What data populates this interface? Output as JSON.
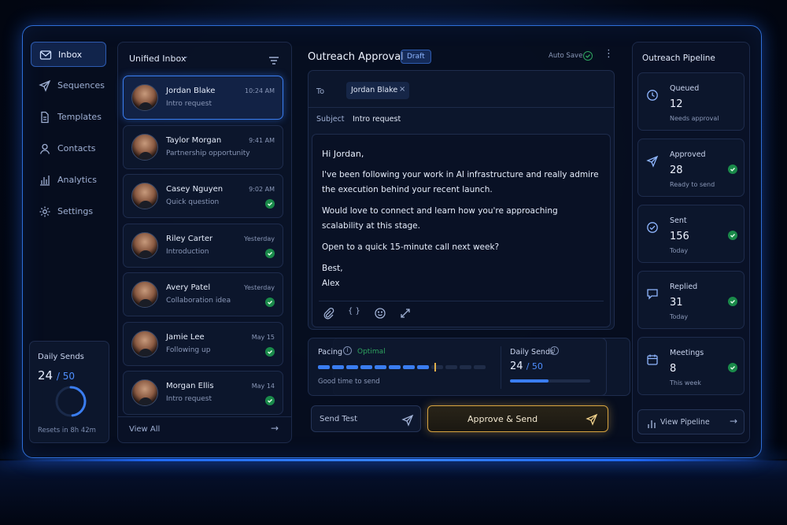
{
  "colors": {
    "accent": "#3a7df0",
    "success": "#2ea35f",
    "gold": "#e0b04a"
  },
  "nav": {
    "items": [
      {
        "label": "Inbox",
        "icon": "mail-icon"
      },
      {
        "label": "Sequences",
        "icon": "send-icon"
      },
      {
        "label": "Templates",
        "icon": "file-icon"
      },
      {
        "label": "Contacts",
        "icon": "user-icon"
      },
      {
        "label": "Analytics",
        "icon": "bar-chart-icon"
      },
      {
        "label": "Settings",
        "icon": "gear-icon"
      }
    ]
  },
  "daily_sends_widget": {
    "title": "Daily Sends",
    "count": "24",
    "total": "/ 50",
    "progress": 0.48,
    "reset_text": "Resets in 8h 42m"
  },
  "inbox": {
    "title": "Unified Inbox",
    "view_all": "View All",
    "items": [
      {
        "name": "Jordan Blake",
        "subject": "Intro request",
        "time": "10:24 AM",
        "checked": false
      },
      {
        "name": "Taylor Morgan",
        "subject": "Partnership opportunity",
        "time": "9:41 AM",
        "checked": false
      },
      {
        "name": "Casey Nguyen",
        "subject": "Quick question",
        "time": "9:02 AM",
        "checked": true
      },
      {
        "name": "Riley Carter",
        "subject": "Introduction",
        "time": "Yesterday",
        "checked": true
      },
      {
        "name": "Avery Patel",
        "subject": "Collaboration idea",
        "time": "Yesterday",
        "checked": true
      },
      {
        "name": "Jamie Lee",
        "subject": "Following up",
        "time": "May 15",
        "checked": true
      },
      {
        "name": "Morgan Ellis",
        "subject": "Intro request",
        "time": "May 14",
        "checked": true
      }
    ]
  },
  "compose": {
    "title": "Outreach Approval",
    "badge": "Draft",
    "autosave": "Auto Save",
    "to_label": "To",
    "to_value": "Jordan Blake",
    "to_remove": "×",
    "subject_label": "Subject",
    "subject_value": "Intro request",
    "body": {
      "greeting": "Hi Jordan,",
      "p1_l1": "I've been following your work in AI infrastructure and really admire",
      "p1_l2": "the execution behind your recent launch.",
      "p2_l1": "Would love to connect and learn how you're approaching",
      "p2_l2": "scalability at this stage.",
      "p3": "Open to a quick 15-minute call next week?",
      "signoff": "Best,",
      "name": "Alex"
    },
    "pacing": {
      "label": "Pacing",
      "status": "Optimal",
      "hint": "Good time to send",
      "level": 0.8
    },
    "daily": {
      "label": "Daily Sends",
      "count": "24",
      "total": "/ 50",
      "progress": 0.48
    },
    "send_test": "Send Test",
    "approve": "Approve & Send"
  },
  "pipeline": {
    "title": "Outreach Pipeline",
    "view_button": "View Pipeline",
    "stages": [
      {
        "label": "Queued",
        "value": "12",
        "sub": "Needs approval",
        "icon": "clock-icon",
        "checked": false
      },
      {
        "label": "Approved",
        "value": "28",
        "sub": "Ready to send",
        "icon": "send-icon",
        "checked": true
      },
      {
        "label": "Sent",
        "value": "156",
        "sub": "Today",
        "icon": "check-circle-icon",
        "checked": true
      },
      {
        "label": "Replied",
        "value": "31",
        "sub": "Today",
        "icon": "chat-icon",
        "checked": true
      },
      {
        "label": "Meetings",
        "value": "8",
        "sub": "This week",
        "icon": "calendar-icon",
        "checked": true
      }
    ]
  }
}
